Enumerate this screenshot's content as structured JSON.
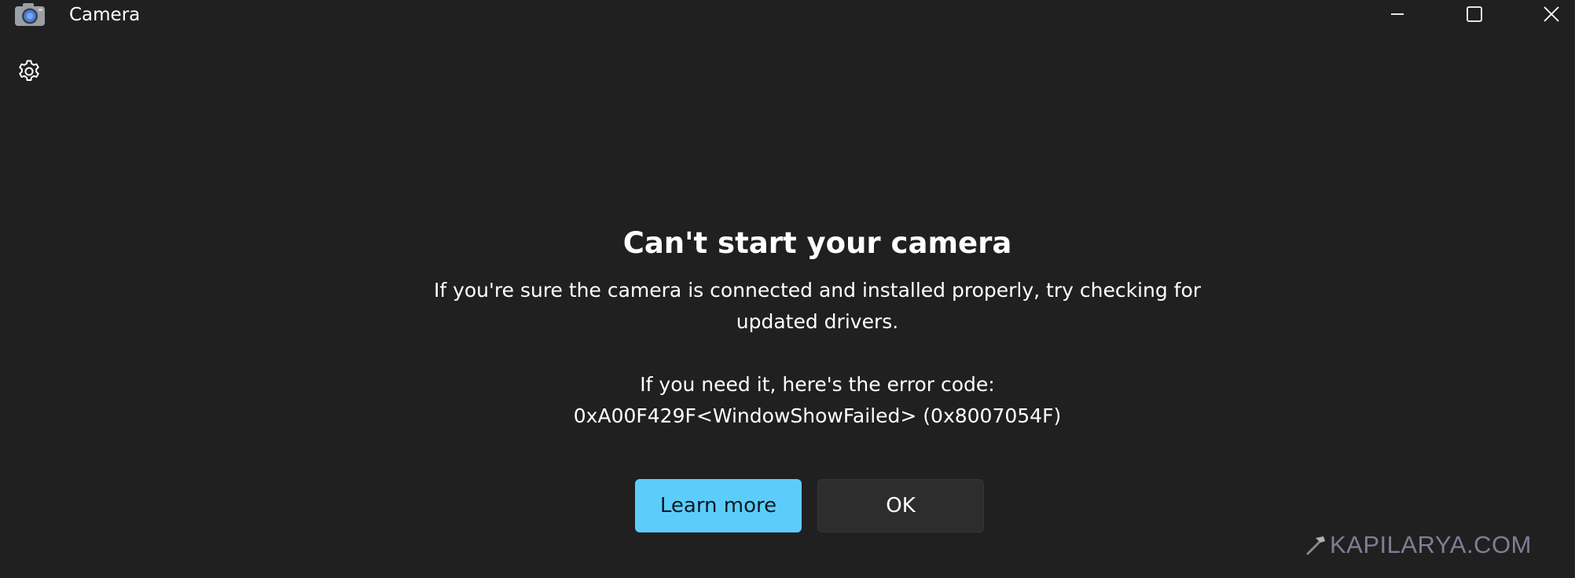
{
  "window": {
    "title": "Camera",
    "app_icon": "camera-app-icon",
    "controls": {
      "minimize_icon": "minimize-icon",
      "maximize_icon": "maximize-icon",
      "close_icon": "close-icon"
    }
  },
  "toolbar": {
    "settings_icon": "gear-icon"
  },
  "error_dialog": {
    "title": "Can't start your camera",
    "description_line1": "If you're sure the camera is connected and installed properly, try checking for",
    "description_line2": "updated drivers.",
    "code_intro": "If you need it, here's the error code:",
    "code": "0xA00F429F<WindowShowFailed> (0x8007054F)",
    "learn_more_label": "Learn more",
    "ok_label": "OK"
  },
  "watermark": {
    "text": "KAPILARYA.COM"
  },
  "colors": {
    "background": "#202020",
    "accent_button": "#5ccdfa",
    "secondary_button": "#2d2d2d",
    "text": "#ffffff",
    "watermark": "#7e7f96"
  }
}
